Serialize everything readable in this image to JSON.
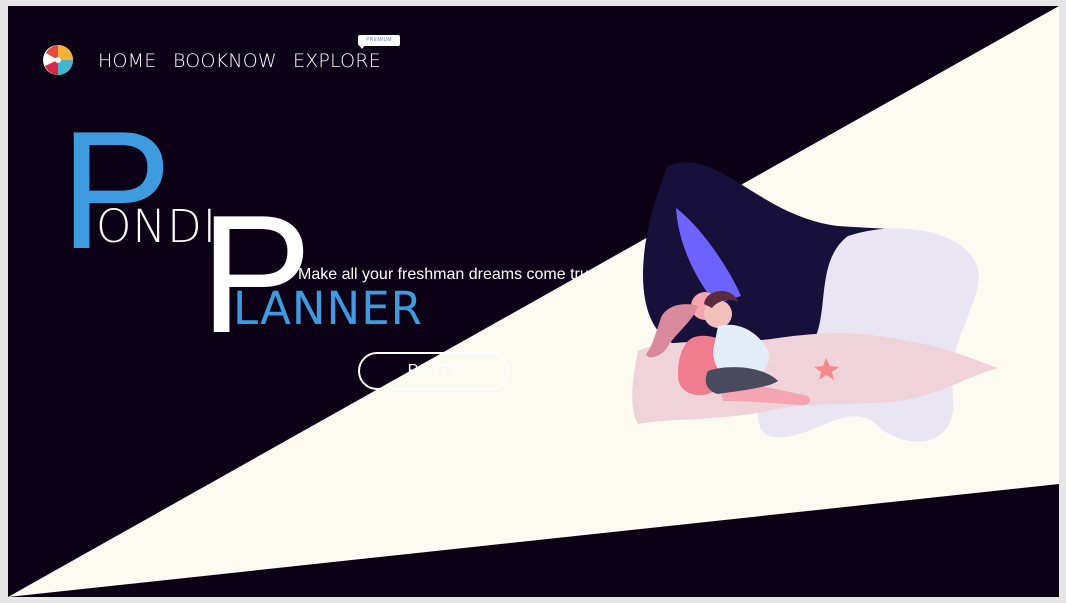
{
  "nav": {
    "home": "HOME",
    "booknow": "BOOKNOW",
    "explore": "EXPLORE",
    "premium_badge": "PREMIUM"
  },
  "hero": {
    "big_letter_1": "P",
    "word_1_rest": "ONDI",
    "big_letter_2": "P",
    "word_2_rest": "LANNER",
    "tagline": "Make all your freshman dreams come true.",
    "party_button": "PARTY"
  },
  "icons": {
    "logo": "beach-ball-icon"
  },
  "colors": {
    "background": "#0b0016",
    "accent_blue": "#3f9be0",
    "cream": "#fdfaf2",
    "sail_purple": "#6c63ff"
  }
}
